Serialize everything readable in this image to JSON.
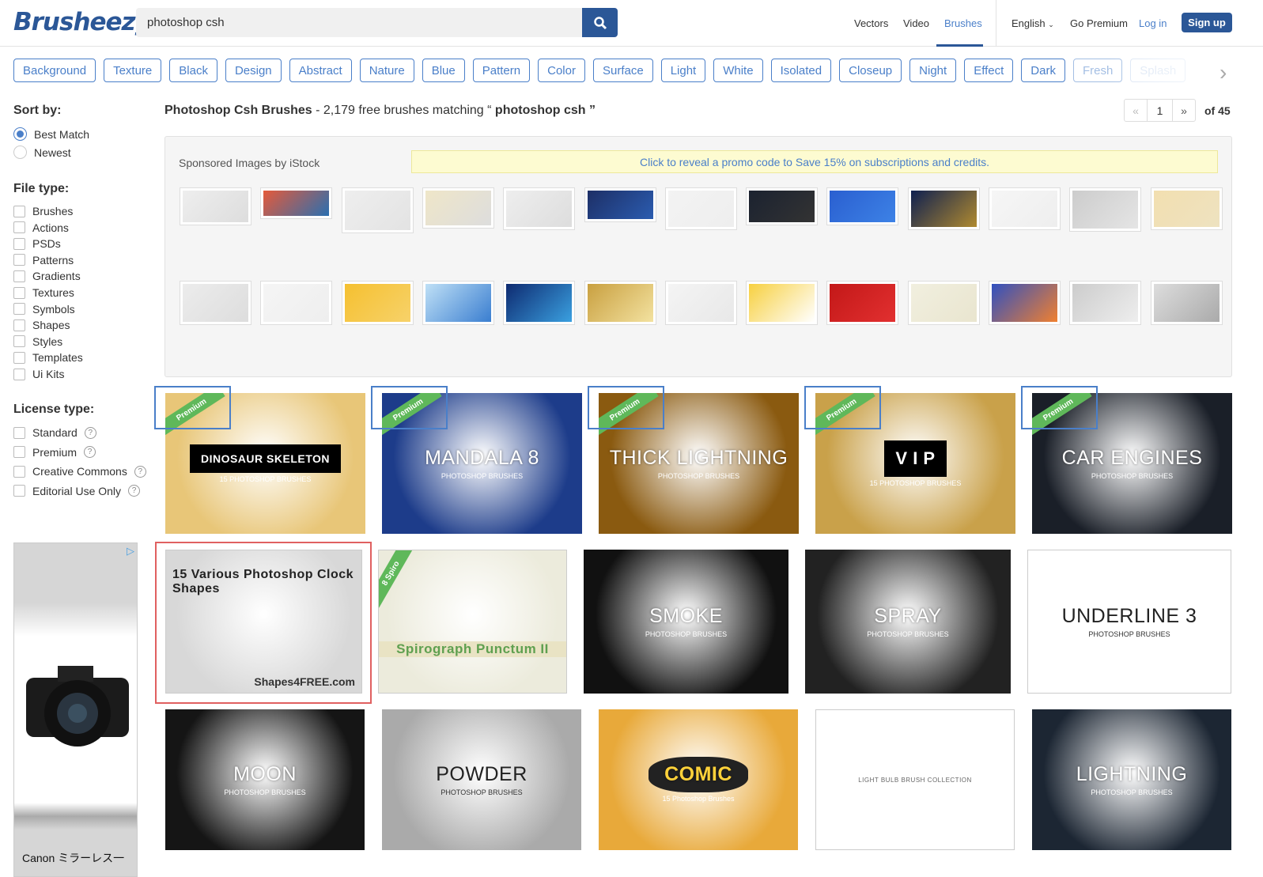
{
  "header": {
    "logo": "Brusheezy",
    "search_value": "photoshop csh",
    "nav": [
      "Vectors",
      "Video",
      "Brushes"
    ],
    "language": "English",
    "go_premium": "Go Premium",
    "login": "Log in",
    "signup": "Sign up"
  },
  "tags": [
    "Background",
    "Texture",
    "Black",
    "Design",
    "Abstract",
    "Nature",
    "Blue",
    "Pattern",
    "Color",
    "Surface",
    "Light",
    "White",
    "Isolated",
    "Closeup",
    "Night",
    "Effect",
    "Dark",
    "Fresh",
    "Splash"
  ],
  "sidebar": {
    "sort_title": "Sort by:",
    "sort_options": [
      "Best Match",
      "Newest"
    ],
    "file_title": "File type:",
    "file_types": [
      "Brushes",
      "Actions",
      "PSDs",
      "Patterns",
      "Gradients",
      "Textures",
      "Symbols",
      "Shapes",
      "Styles",
      "Templates",
      "Ui Kits"
    ],
    "license_title": "License type:",
    "licenses": [
      "Standard",
      "Premium",
      "Creative Commons",
      "Editorial Use Only"
    ]
  },
  "ad": {
    "caption": "Canon ミラーレス一"
  },
  "results": {
    "title": "Photoshop Csh Brushes",
    "summary": " - 2,179 free brushes matching “",
    "query": " photoshop csh ",
    "close": "”",
    "page": "1",
    "of": "of 45",
    "prev": "«",
    "next": "»"
  },
  "sponsored": {
    "label": "Sponsored Images by iStock",
    "promo": "Click to reveal a promo code to Save 15% on subscriptions and credits."
  },
  "premium_label": "Premium",
  "cards": [
    {
      "title": "DINOSAUR SKELETON",
      "sub": "15 PHOTOSHOP BRUSHES",
      "premium": true,
      "bg": "#e8c678"
    },
    {
      "title": "MANDALA 8",
      "sub": "PHOTOSHOP BRUSHES",
      "premium": true,
      "bg": "#1d3c8a"
    },
    {
      "title": "THICK LIGHTNING",
      "sub": "PHOTOSHOP BRUSHES",
      "premium": true,
      "bg": "#8a5a10"
    },
    {
      "title": "V I P",
      "sub": "15 PHOTOSHOP BRUSHES",
      "premium": true,
      "bg": "#c9a14a"
    },
    {
      "title": "CAR ENGINES",
      "sub": "PHOTOSHOP BRUSHES",
      "premium": true,
      "bg": "#1a1f28"
    },
    {
      "title": "15 Various Photoshop Clock Shapes",
      "sub": "Shapes4FREE.com",
      "premium": false,
      "bg": "#d8d8d8"
    },
    {
      "title": "Spirograph Punctum II",
      "sub": "8 Spiro",
      "premium": false,
      "bg": "#ecebdc"
    },
    {
      "title": "SMOKE",
      "sub": "PHOTOSHOP BRUSHES",
      "premium": false,
      "bg": "#111"
    },
    {
      "title": "SPRAY",
      "sub": "PHOTOSHOP BRUSHES",
      "premium": false,
      "bg": "#222"
    },
    {
      "title": "UNDERLINE 3",
      "sub": "PHOTOSHOP BRUSHES",
      "premium": false,
      "bg": "#fff"
    },
    {
      "title": "MOON",
      "sub": "PHOTOSHOP BRUSHES",
      "premium": false,
      "bg": "#151515"
    },
    {
      "title": "POWDER",
      "sub": "PHOTOSHOP BRUSHES",
      "premium": false,
      "bg": "#aaa"
    },
    {
      "title": "COMIC",
      "sub": "15 Photoshop Brushes",
      "premium": false,
      "bg": "#e8a93a"
    },
    {
      "title": "LIGHT BULB BRUSH COLLECTION",
      "sub": "",
      "premium": false,
      "bg": "#fff"
    },
    {
      "title": "LIGHTNING",
      "sub": "PHOTOSHOP BRUSHES",
      "premium": false,
      "bg": "#1c2633"
    }
  ],
  "colors": {
    "accent": "#2b5797",
    "link": "#4a7fc9",
    "premium": "#5fb85a"
  }
}
